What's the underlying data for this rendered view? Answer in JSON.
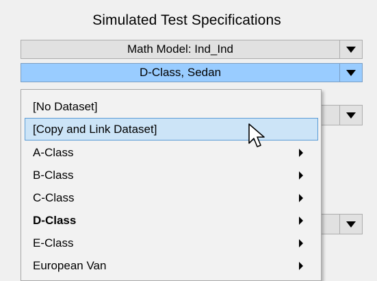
{
  "section": {
    "title": "Simulated Test Specifications"
  },
  "math_model_select": {
    "value": "Math Model: Ind_Ind"
  },
  "vehicle_class_select": {
    "value": "D-Class, Sedan"
  },
  "dataset_menu": {
    "items": [
      {
        "label": "[No Dataset]",
        "submenu": false,
        "bold": false,
        "hover": false
      },
      {
        "label": "[Copy and Link Dataset]",
        "submenu": false,
        "bold": false,
        "hover": true
      },
      {
        "label": "A-Class",
        "submenu": true,
        "bold": false,
        "hover": false
      },
      {
        "label": "B-Class",
        "submenu": true,
        "bold": false,
        "hover": false
      },
      {
        "label": "C-Class",
        "submenu": true,
        "bold": false,
        "hover": false
      },
      {
        "label": "D-Class",
        "submenu": true,
        "bold": true,
        "hover": false
      },
      {
        "label": "E-Class",
        "submenu": true,
        "bold": false,
        "hover": false
      },
      {
        "label": "European Van",
        "submenu": true,
        "bold": false,
        "hover": false
      }
    ]
  },
  "colors": {
    "selected_row": "#99ccff",
    "menu_hover": "#cce4f7",
    "menu_hover_border": "#5a9bd5"
  },
  "icons": {
    "dropdown": "chevron-down-icon",
    "submenu": "submenu-arrow-icon",
    "cursor": "mouse-pointer-icon"
  }
}
